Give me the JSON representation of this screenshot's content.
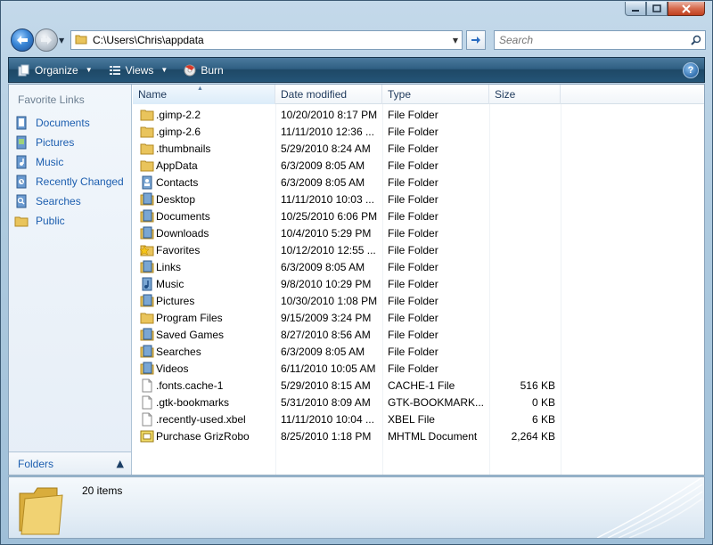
{
  "window": {
    "caption_buttons": [
      "minimize",
      "maximize",
      "close"
    ]
  },
  "address_bar": {
    "path": "C:\\Users\\Chris\\appdata"
  },
  "search": {
    "placeholder": "Search"
  },
  "toolbar": {
    "organize_label": "Organize",
    "views_label": "Views",
    "burn_label": "Burn",
    "help_label": "?"
  },
  "nav_pane": {
    "title": "Favorite Links",
    "items": [
      {
        "label": "Documents",
        "icon": "documents-icon"
      },
      {
        "label": "Pictures",
        "icon": "pictures-icon"
      },
      {
        "label": "Music",
        "icon": "music-icon"
      },
      {
        "label": "Recently Changed",
        "icon": "recently-changed-icon"
      },
      {
        "label": "Searches",
        "icon": "searches-icon"
      },
      {
        "label": "Public",
        "icon": "folder-icon"
      }
    ],
    "folders_label": "Folders"
  },
  "columns": {
    "name": "Name",
    "date": "Date modified",
    "type": "Type",
    "size": "Size"
  },
  "files": [
    {
      "name": ".gimp-2.2",
      "date": "10/20/2010 8:17 PM",
      "type": "File Folder",
      "size": "",
      "icon": "folder"
    },
    {
      "name": ".gimp-2.6",
      "date": "11/11/2010 12:36 ...",
      "type": "File Folder",
      "size": "",
      "icon": "folder"
    },
    {
      "name": ".thumbnails",
      "date": "5/29/2010 8:24 AM",
      "type": "File Folder",
      "size": "",
      "icon": "folder"
    },
    {
      "name": "AppData",
      "date": "6/3/2009 8:05 AM",
      "type": "File Folder",
      "size": "",
      "icon": "folder"
    },
    {
      "name": "Contacts",
      "date": "6/3/2009 8:05 AM",
      "type": "File Folder",
      "size": "",
      "icon": "contacts"
    },
    {
      "name": "Desktop",
      "date": "11/11/2010 10:03 ...",
      "type": "File Folder",
      "size": "",
      "icon": "special"
    },
    {
      "name": "Documents",
      "date": "10/25/2010 6:06 PM",
      "type": "File Folder",
      "size": "",
      "icon": "special"
    },
    {
      "name": "Downloads",
      "date": "10/4/2010 5:29 PM",
      "type": "File Folder",
      "size": "",
      "icon": "special"
    },
    {
      "name": "Favorites",
      "date": "10/12/2010 12:55 ...",
      "type": "File Folder",
      "size": "",
      "icon": "favorites"
    },
    {
      "name": "Links",
      "date": "6/3/2009 8:05 AM",
      "type": "File Folder",
      "size": "",
      "icon": "special"
    },
    {
      "name": "Music",
      "date": "9/8/2010 10:29 PM",
      "type": "File Folder",
      "size": "",
      "icon": "music"
    },
    {
      "name": "Pictures",
      "date": "10/30/2010 1:08 PM",
      "type": "File Folder",
      "size": "",
      "icon": "special"
    },
    {
      "name": "Program Files",
      "date": "9/15/2009 3:24 PM",
      "type": "File Folder",
      "size": "",
      "icon": "folder"
    },
    {
      "name": "Saved Games",
      "date": "8/27/2010 8:56 AM",
      "type": "File Folder",
      "size": "",
      "icon": "special"
    },
    {
      "name": "Searches",
      "date": "6/3/2009 8:05 AM",
      "type": "File Folder",
      "size": "",
      "icon": "special"
    },
    {
      "name": "Videos",
      "date": "6/11/2010 10:05 AM",
      "type": "File Folder",
      "size": "",
      "icon": "special"
    },
    {
      "name": ".fonts.cache-1",
      "date": "5/29/2010 8:15 AM",
      "type": "CACHE-1 File",
      "size": "516 KB",
      "icon": "file"
    },
    {
      "name": ".gtk-bookmarks",
      "date": "5/31/2010 8:09 AM",
      "type": "GTK-BOOKMARK...",
      "size": "0 KB",
      "icon": "file"
    },
    {
      "name": ".recently-used.xbel",
      "date": "11/11/2010 10:04 ...",
      "type": "XBEL File",
      "size": "6 KB",
      "icon": "file"
    },
    {
      "name": "Purchase GrizRobo",
      "date": "8/25/2010 1:18 PM",
      "type": "MHTML Document",
      "size": "2,264 KB",
      "icon": "mhtml"
    }
  ],
  "details": {
    "item_count": "20 items"
  }
}
